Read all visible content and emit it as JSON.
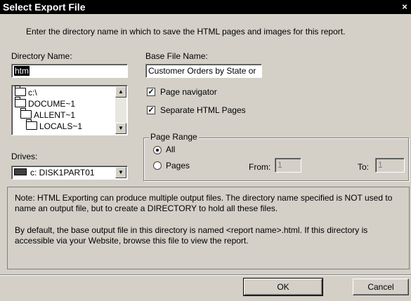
{
  "window": {
    "title": "Select Export File",
    "close_glyph": "×"
  },
  "instructions": "Enter the directory name in which to save the HTML pages and images for this report.",
  "directory": {
    "label": "Directory Name:",
    "value": "htm",
    "tree": [
      "c:\\",
      "DOCUME~1",
      "ALLENT~1",
      "LOCALS~1"
    ]
  },
  "base_file": {
    "label": "Base File Name:",
    "value": "Customer Orders by State or"
  },
  "options": {
    "page_navigator": {
      "label": "Page navigator",
      "checked": true
    },
    "separate_pages": {
      "label": "Separate HTML Pages",
      "checked": true
    }
  },
  "drives": {
    "label": "Drives:",
    "value": "c: DISK1PART01"
  },
  "page_range": {
    "title": "Page Range",
    "all_label": "All",
    "pages_label": "Pages",
    "from_label": "From:",
    "from_value": "1",
    "to_label": "To:",
    "to_value": "1",
    "selected": "All"
  },
  "note": {
    "paragraph1": "Note: HTML Exporting can produce multiple output files. The directory name specified is NOT used to name an output file, but to create a DIRECTORY to hold all these files.",
    "paragraph2": "By default, the base output file in this directory is named <report name>.html. If this directory is accessible via your Website, browse this file to view the report."
  },
  "buttons": {
    "ok": "OK",
    "cancel": "Cancel"
  }
}
